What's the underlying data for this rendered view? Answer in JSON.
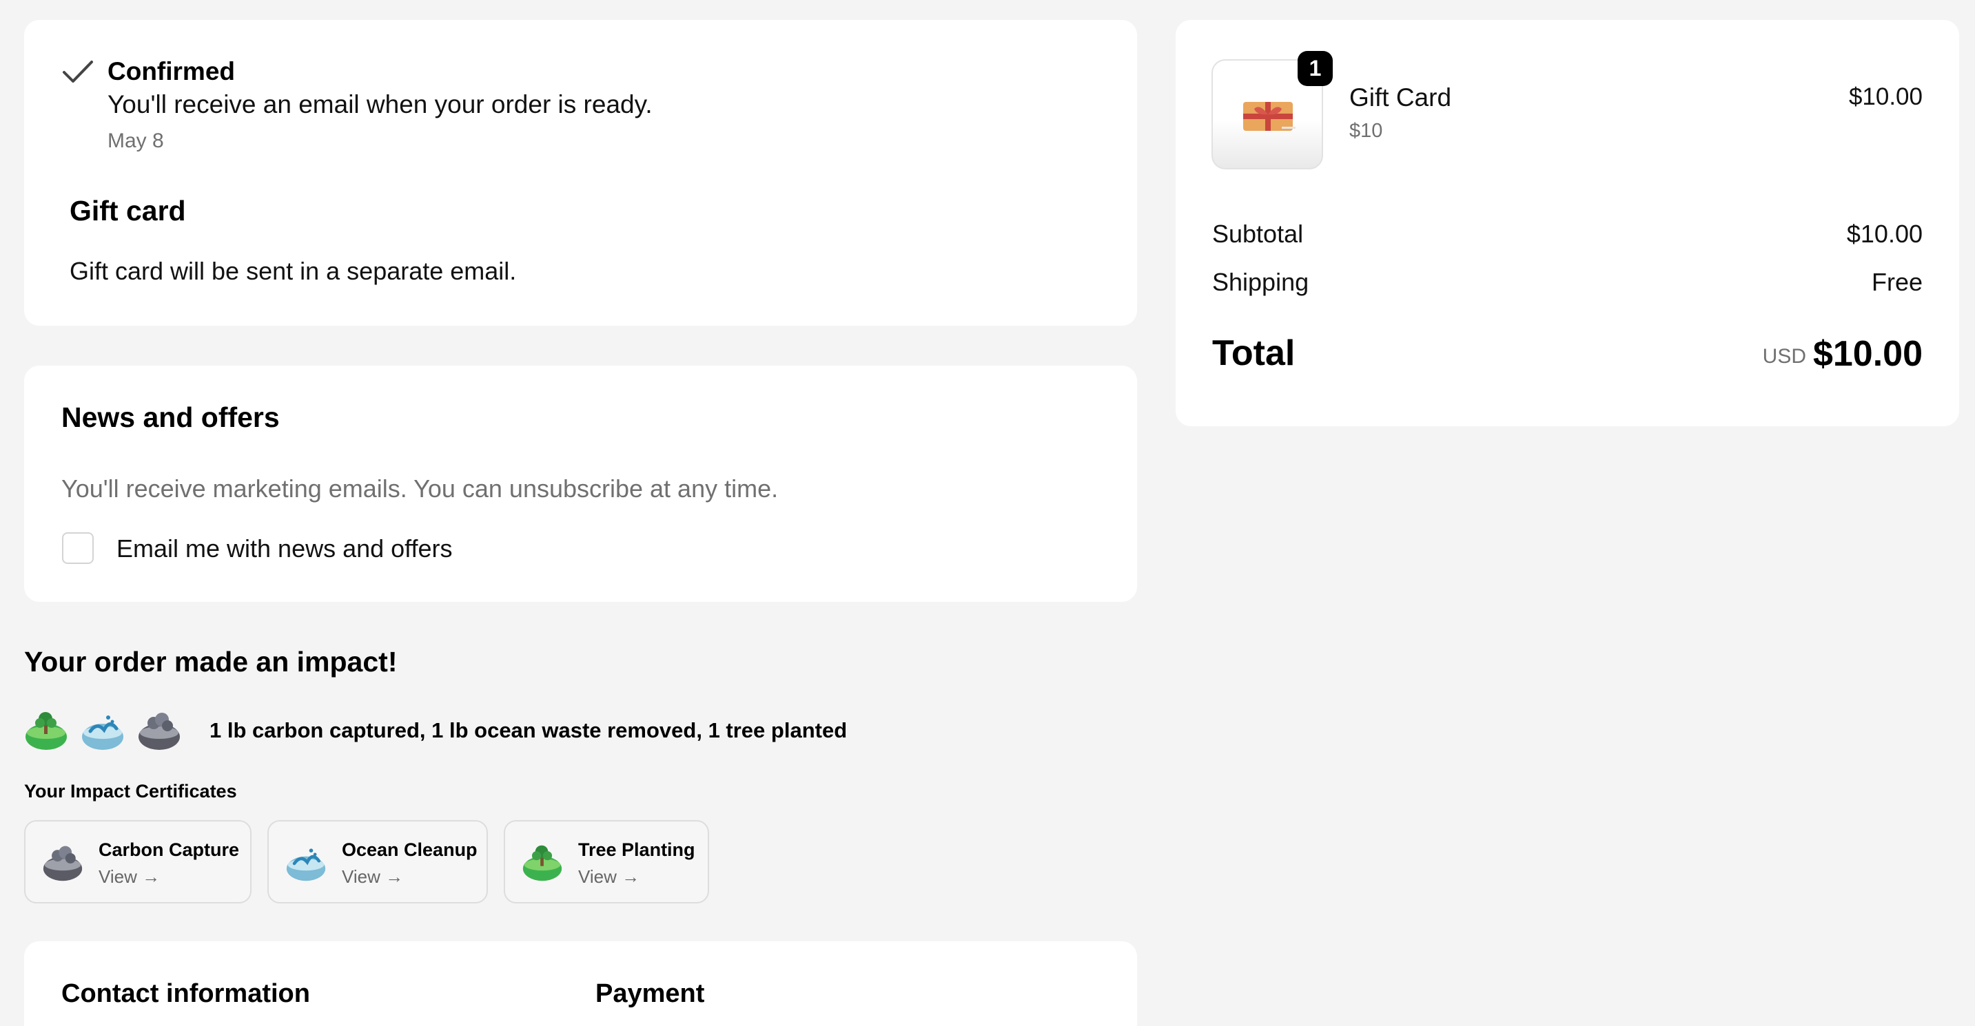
{
  "status": {
    "title": "Confirmed",
    "message": "You'll receive an email when your order is ready.",
    "date": "May 8",
    "icon": "checkmark-icon"
  },
  "gift_card": {
    "heading": "Gift card",
    "text": "Gift card will be sent in a separate email."
  },
  "news": {
    "heading": "News and offers",
    "description": "You'll receive marketing emails. You can unsubscribe at any time.",
    "checkbox_label": "Email me with news and offers",
    "checked": false
  },
  "impact": {
    "heading": "Your order made an impact!",
    "summary": "1 lb carbon captured, 1 lb ocean waste removed, 1 tree planted",
    "icons": [
      "tree-planting-icon",
      "ocean-cleanup-icon",
      "carbon-capture-icon"
    ],
    "certificates_label": "Your Impact Certificates",
    "certificates": [
      {
        "name": "Carbon Capture",
        "link": "View →",
        "icon": "carbon-capture-icon"
      },
      {
        "name": "Ocean Cleanup",
        "link": "View →",
        "icon": "ocean-cleanup-icon"
      },
      {
        "name": "Tree Planting",
        "link": "View →",
        "icon": "tree-planting-icon"
      }
    ]
  },
  "contact": {
    "heading": "Contact information",
    "payment_heading": "Payment"
  },
  "order_summary": {
    "item": {
      "name": "Gift Card",
      "variant": "$10",
      "price": "$10.00",
      "quantity": "1",
      "image_icon": "gift-box-icon"
    },
    "subtotal_label": "Subtotal",
    "subtotal_value": "$10.00",
    "shipping_label": "Shipping",
    "shipping_value": "Free",
    "total_label": "Total",
    "currency": "USD",
    "total_value": "$10.00"
  },
  "colors": {
    "page_bg": "#f4f4f4",
    "card_bg": "#ffffff",
    "muted_text": "#707070",
    "badge_bg": "#000000"
  }
}
